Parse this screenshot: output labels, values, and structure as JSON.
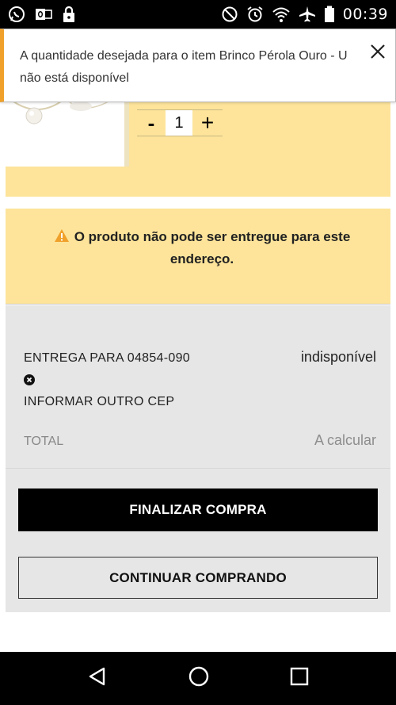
{
  "status_bar": {
    "time": "00:39",
    "left_icons": [
      "whatsapp-icon",
      "outlook-icon",
      "lock-icon"
    ],
    "right_icons": [
      "do-not-disturb-icon",
      "alarm-icon",
      "wifi-icon",
      "airplane-mode-icon",
      "battery-icon"
    ]
  },
  "toast": {
    "message": "A quantidade desejada para o item Brinco Pérola Ouro - U não está disponível",
    "close_icon": "close-icon"
  },
  "cart_item": {
    "quantity": "1",
    "minus_label": "-",
    "plus_label": "+"
  },
  "warning": {
    "icon": "warning-icon",
    "text": "O produto não pode ser entregue para este endereço."
  },
  "summary": {
    "delivery_label": "ENTREGA PARA 04854-090",
    "delivery_value": "indisponível",
    "other_cep_label": "INFORMAR OUTRO CEP",
    "total_label": "TOTAL",
    "total_value": "A calcular"
  },
  "buttons": {
    "checkout": "FINALIZAR COMPRA",
    "continue": "CONTINUAR COMPRANDO"
  },
  "nav_bar": {
    "back_icon": "back-icon",
    "home_icon": "home-icon",
    "recents_icon": "recents-icon"
  },
  "colors": {
    "highlight_yellow": "#fde49a",
    "toast_accent": "#f0a12b",
    "summary_gray": "#e6e6e6",
    "warning_orange": "#f0a12b"
  }
}
